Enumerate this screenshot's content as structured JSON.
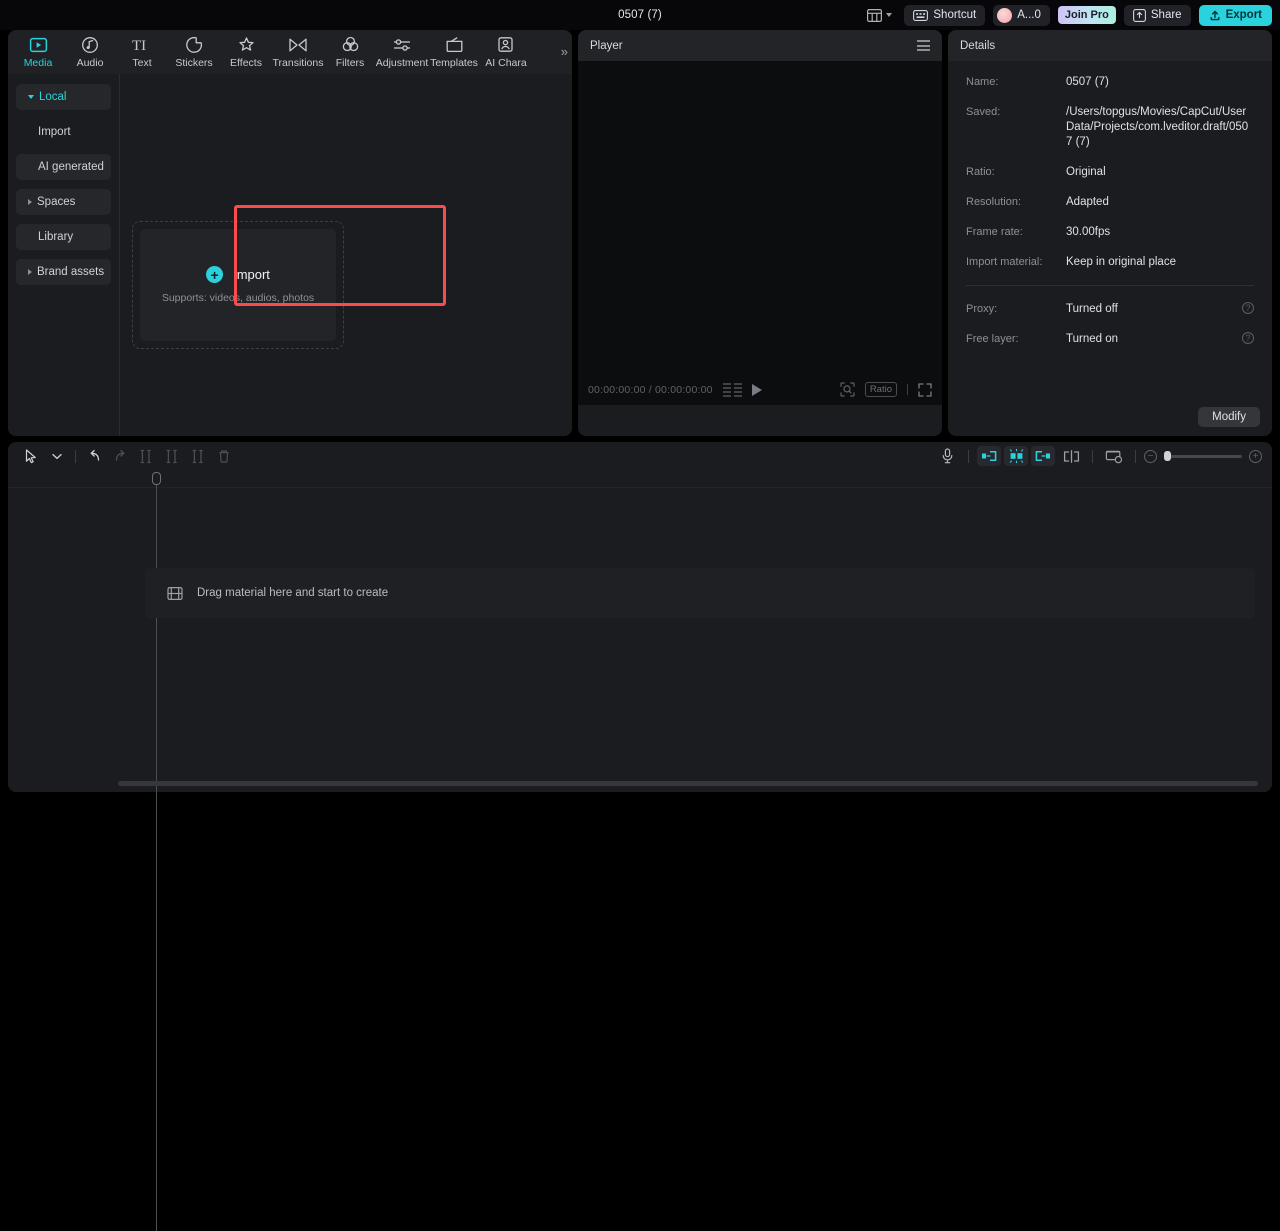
{
  "titlebar": {
    "project_title": "0507 (7)",
    "layout_icon": "layout-grid-icon",
    "shortcut_label": "Shortcut",
    "shortcut_icon": "keyboard-icon",
    "account_label": "A...0",
    "join_pro_label": "Join Pro",
    "share_label": "Share",
    "share_icon": "share-box-icon",
    "export_label": "Export",
    "export_icon": "upload-icon",
    "accent_color": "#2ad2de"
  },
  "tabs": [
    {
      "label": "Media",
      "icon": "media-play-frame-icon",
      "active": true
    },
    {
      "label": "Audio",
      "icon": "audio-note-icon",
      "active": false
    },
    {
      "label": "Text",
      "icon": "text-ti-icon",
      "active": false
    },
    {
      "label": "Stickers",
      "icon": "sticker-circle-icon",
      "active": false
    },
    {
      "label": "Effects",
      "icon": "effects-sparkle-icon",
      "active": false
    },
    {
      "label": "Transitions",
      "icon": "transitions-bowtie-icon",
      "active": false
    },
    {
      "label": "Filters",
      "icon": "filters-circles-icon",
      "active": false
    },
    {
      "label": "Adjustment",
      "icon": "adjustment-sliders-icon",
      "active": false
    },
    {
      "label": "Templates",
      "icon": "templates-box-icon",
      "active": false
    },
    {
      "label": "AI Chara",
      "icon": "ai-character-icon",
      "active": false
    }
  ],
  "tabs_overflow_label": "»",
  "sidenav": [
    {
      "label": "Local",
      "state": "expanded",
      "selected": true
    },
    {
      "label": "Import",
      "state": "none",
      "selected": false
    },
    {
      "label": "AI generated",
      "state": "none",
      "selected": false
    },
    {
      "label": "Spaces",
      "state": "collapsed",
      "selected": false
    },
    {
      "label": "Library",
      "state": "none",
      "selected": false
    },
    {
      "label": "Brand assets",
      "state": "collapsed",
      "selected": false
    }
  ],
  "dropzone": {
    "import_label": "Import",
    "plus_icon": "plus-circle-icon",
    "supports_text": "Supports: videos, audios, photos",
    "highlight_color": "#fc4b4b"
  },
  "player": {
    "title": "Player",
    "menu_icon": "hamburger-menu-icon",
    "current_time": "00:00:00:00",
    "time_separator": "/",
    "total_time": "00:00:00:00",
    "timecode": "00:00:00:00 / 00:00:00:00",
    "play_icon": "play-triangle-icon",
    "frame_step_icon": "frame-step-icon",
    "magnifier_icon": "magnifier-frame-icon",
    "ratio_label": "Ratio",
    "fullscreen_icon": "fullscreen-expand-icon"
  },
  "details": {
    "title": "Details",
    "rows": [
      {
        "key": "Name:",
        "value": "0507 (7)",
        "help": false
      },
      {
        "key": "Saved:",
        "value": "/Users/topgus/Movies/CapCut/User Data/Projects/com.lveditor.draft/0507 (7)",
        "help": false
      },
      {
        "key": "Ratio:",
        "value": "Original",
        "help": false
      },
      {
        "key": "Resolution:",
        "value": "Adapted",
        "help": false
      },
      {
        "key": "Frame rate:",
        "value": "30.00fps",
        "help": false
      },
      {
        "key": "Import material:",
        "value": "Keep in original place",
        "help": false
      }
    ],
    "rows_after_sep": [
      {
        "key": "Proxy:",
        "value": "Turned off",
        "help": true
      },
      {
        "key": "Free layer:",
        "value": "Turned on",
        "help": true
      }
    ],
    "help_icon": "question-mark-icon",
    "modify_label": "Modify"
  },
  "timeline": {
    "left_tools": [
      {
        "icon": "cursor-select-icon",
        "enabled": true
      },
      {
        "icon": "chevron-down-icon",
        "enabled": true
      },
      {
        "icon": "undo-icon",
        "enabled": true
      },
      {
        "icon": "redo-icon",
        "enabled": false
      },
      {
        "icon": "split-icon",
        "enabled": false
      },
      {
        "icon": "trim-left-icon",
        "enabled": false
      },
      {
        "icon": "trim-right-icon",
        "enabled": false
      },
      {
        "icon": "delete-trash-icon",
        "enabled": false
      }
    ],
    "right_tools": [
      {
        "icon": "microphone-icon",
        "active": false
      },
      {
        "icon": "snap-left-icon",
        "active": true
      },
      {
        "icon": "auto-snap-icon",
        "active": true
      },
      {
        "icon": "snap-right-icon",
        "active": true
      },
      {
        "icon": "split-marker-icon",
        "active": false
      },
      {
        "icon": "adjust-track-icon",
        "active": false
      }
    ],
    "zoom_out_icon": "zoom-out-icon",
    "zoom_in_icon": "zoom-in-icon",
    "zoom_value": 0,
    "empty_track_text": "Drag material here and start to create",
    "empty_track_icon": "film-strip-icon",
    "playhead_position": "00:00:00:00"
  }
}
